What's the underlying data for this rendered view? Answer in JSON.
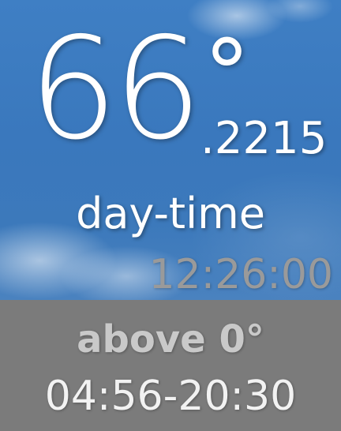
{
  "weather": {
    "temperature_whole": "66",
    "degree_symbol": "°",
    "temperature_decimal": ".2215",
    "period": "day-time",
    "time": "12:26:00"
  },
  "info": {
    "condition": "above 0°",
    "time_range": "04:56-20:30"
  },
  "colors": {
    "sky": "#3c79bb",
    "panel": "#7b7b7b",
    "primary_text": "#ffffff",
    "clock_text": "#9a9a9a",
    "condition_text": "#c9c9c9"
  }
}
